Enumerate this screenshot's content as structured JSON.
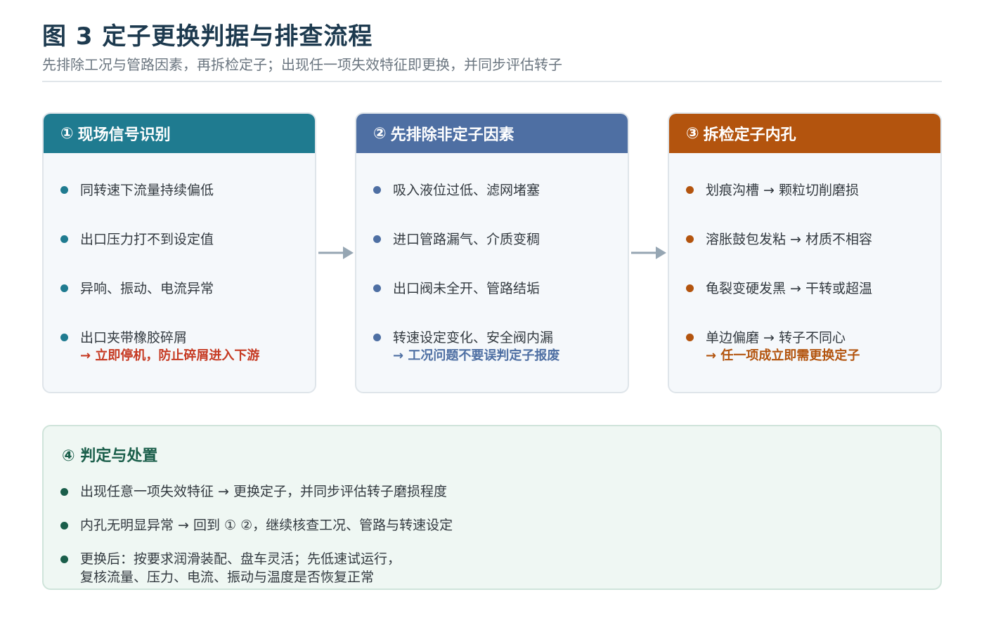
{
  "title": "图 3 定子更换判据与排查流程",
  "subtitle": "先排除工况与管路因素，再拆检定子；出现任一项失效特征即更换，并同步评估转子",
  "colors": {
    "card1": "#1f7b90",
    "card2": "#4e6fa3",
    "card3": "#b3540e",
    "panel": "#1a5e4a",
    "alert": "#c63a23"
  },
  "cards": [
    {
      "number": "①",
      "heading": "现场信号识别",
      "items": [
        "同转速下流量持续偏低",
        "出口压力打不到设定值",
        "异响、振动、电流异常",
        "出口夹带橡胶碎屑"
      ],
      "note": "→ 立即停机，防止碎屑进入下游"
    },
    {
      "number": "②",
      "heading": "先排除非定子因素",
      "items": [
        "吸入液位过低、滤网堵塞",
        "进口管路漏气、介质变稠",
        "出口阀未全开、管路结垢",
        "转速设定变化、安全阀内漏"
      ],
      "note": "→ 工况问题不要误判定子报废"
    },
    {
      "number": "③",
      "heading": "拆检定子内孔",
      "items": [
        "划痕沟槽 → 颗粒切削磨损",
        "溶胀鼓包发粘 → 材质不相容",
        "龟裂变硬发黑 → 干转或超温",
        "单边偏磨 → 转子不同心"
      ],
      "note": "→ 任一项成立即需更换定子"
    }
  ],
  "decision": {
    "number": "④",
    "heading": "判定与处置",
    "items": [
      "出现任意一项失效特征 → 更换定子，并同步评估转子磨损程度",
      "内孔无明显异常 → 回到 ① ②，继续核查工况、管路与转速设定",
      "更换后：按要求润滑装配、盘车灵活；先低速试运行，",
      "复核流量、压力、电流、振动与温度是否恢复正常"
    ]
  }
}
